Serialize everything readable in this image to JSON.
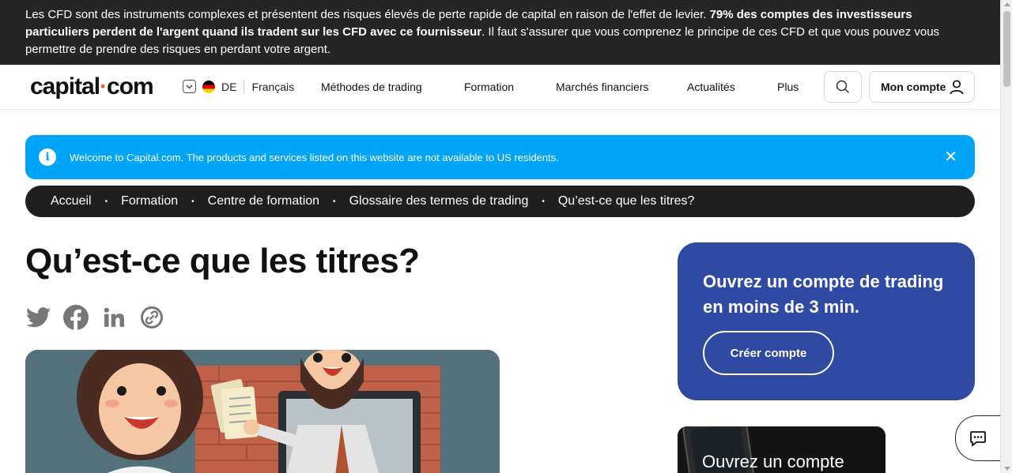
{
  "risk_warning": {
    "text_start": "Les CFD sont des instruments complexes et présentent des risques élevés de perte rapide de capital en raison de l'effet de levier. ",
    "text_bold": "79% des comptes des investisseurs particuliers perdent de l'argent quand ils tradent sur les CFD avec ce fournisseur",
    "text_end": ". Il faut s'assurer que vous comprenez le principe de ces CFD et que vous pouvez vous permettre de prendre des risques en perdant votre argent."
  },
  "header": {
    "logo_left": "capital",
    "logo_dot": "·",
    "logo_right": "com",
    "region_code": "DE",
    "language": "Français",
    "nav": [
      "Méthodes de trading",
      "Formation",
      "Marchés financiers",
      "Actualités",
      "Plus"
    ],
    "account_label": "Mon compte"
  },
  "info_banner": {
    "icon": "i",
    "text": "Welcome to Capital.com. The products and services listed on this website are not available to US residents.",
    "close": "✕"
  },
  "breadcrumb": [
    "Accueil",
    "Formation",
    "Centre de formation",
    "Glossaire des termes de trading",
    "Qu’est-ce que les titres?"
  ],
  "breadcrumb_sep": "•",
  "article": {
    "title": "Qu’est-ce que les titres?"
  },
  "share_icons": [
    "twitter-icon",
    "facebook-icon",
    "linkedin-icon",
    "copy-link-icon"
  ],
  "cta": {
    "title": "Ouvrez un compte de trading en moins de 3 min.",
    "button": "Créer compte"
  },
  "promo2": {
    "text": "Ouvrez un compte"
  },
  "colors": {
    "risk_bg": "#252525",
    "banner_blue": "#00a5f8",
    "cta_blue": "#2e4aa2",
    "logo_dot": "#ff5b2e"
  }
}
